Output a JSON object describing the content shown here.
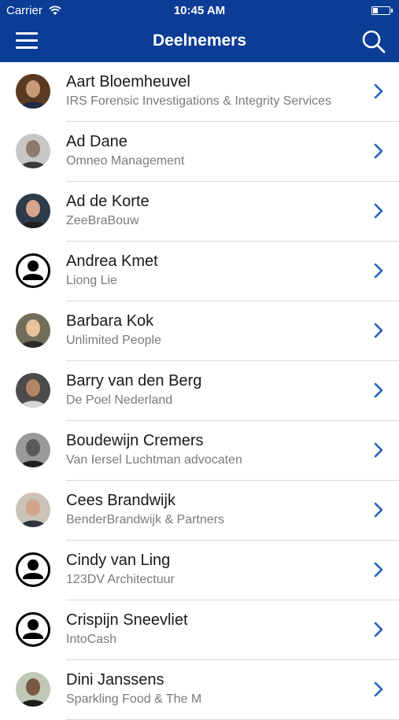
{
  "status_bar": {
    "carrier": "Carrier",
    "time": "10:45 AM"
  },
  "header": {
    "title": "Deelnemers",
    "menu_icon": "hamburger-menu-icon",
    "search_icon": "search-icon"
  },
  "colors": {
    "header_bg": "#0b3d96",
    "chevron": "#1f5fbf",
    "separator": "#d9d9d9"
  },
  "participants": [
    {
      "name": "Aart Bloemheuvel",
      "company": "IRS Forensic Investigations & Integrity Services",
      "avatar": "photo"
    },
    {
      "name": "Ad Dane",
      "company": "Omneo Management",
      "avatar": "photo"
    },
    {
      "name": "Ad de Korte",
      "company": "ZeeBraBouw",
      "avatar": "photo"
    },
    {
      "name": "Andrea Kmet",
      "company": "Liong Lie",
      "avatar": "placeholder"
    },
    {
      "name": "Barbara Kok",
      "company": "Unlimited People",
      "avatar": "photo"
    },
    {
      "name": "Barry van den Berg",
      "company": "De Poel Nederland",
      "avatar": "photo"
    },
    {
      "name": "Boudewijn Cremers",
      "company": "Van Iersel Luchtman advocaten",
      "avatar": "photo"
    },
    {
      "name": "Cees Brandwijk",
      "company": "BenderBrandwijk & Partners",
      "avatar": "photo"
    },
    {
      "name": "Cindy van Ling",
      "company": "123DV Architectuur",
      "avatar": "placeholder"
    },
    {
      "name": "Crispijn Sneevliet",
      "company": "IntoCash",
      "avatar": "placeholder"
    },
    {
      "name": "Dini Janssens",
      "company": "Sparkling Food & The M",
      "avatar": "photo"
    }
  ]
}
